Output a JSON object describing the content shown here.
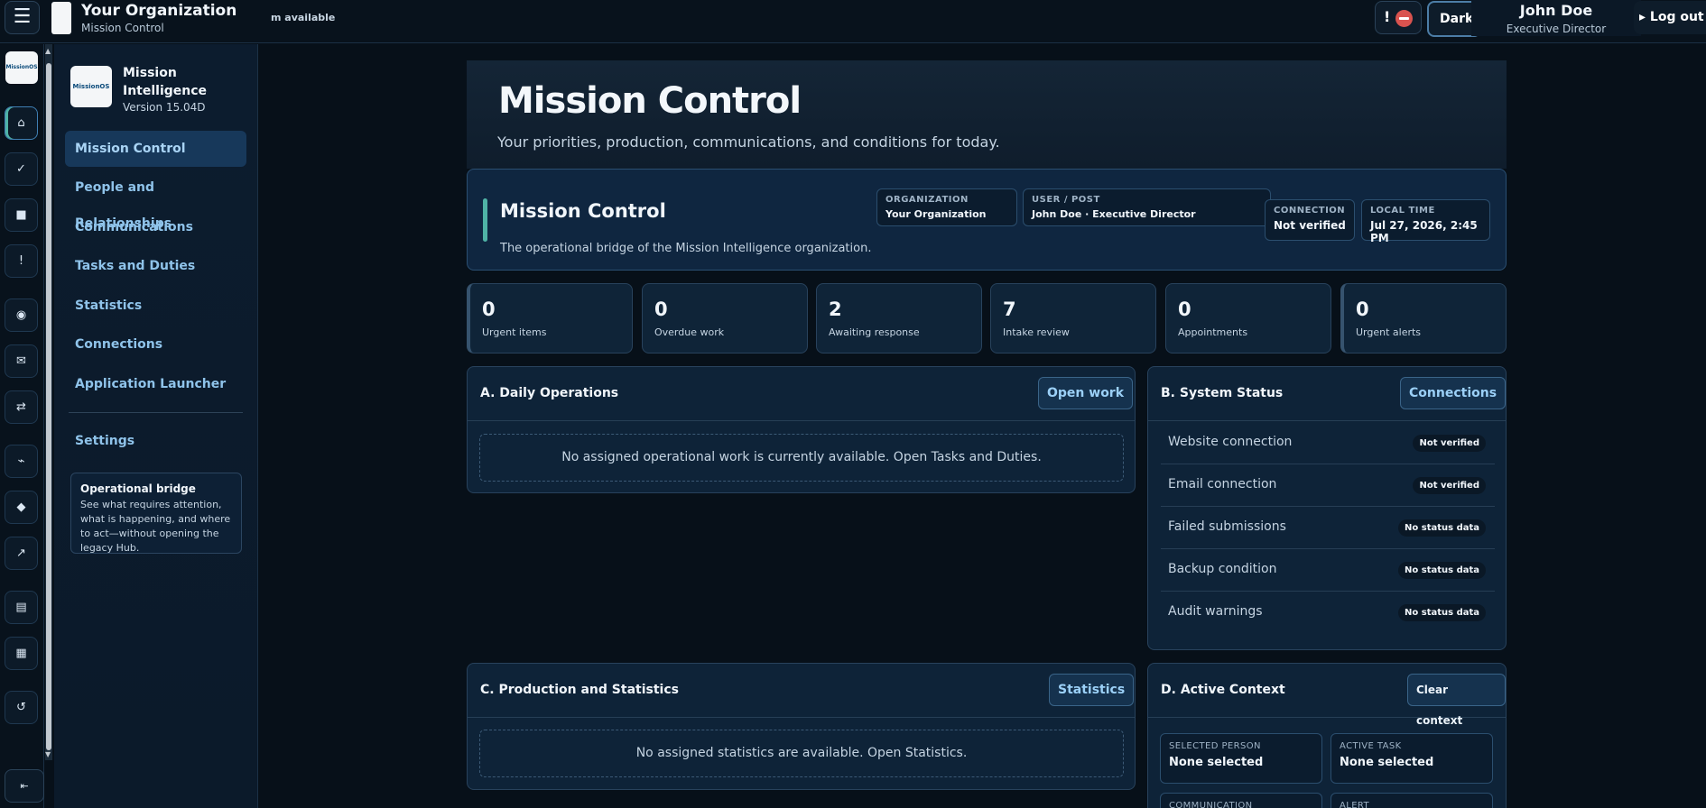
{
  "topbar": {
    "menu_glyph": "☰",
    "org_title": "Your Organization",
    "org_subtitle": "Mission Control",
    "availability_text": "m available",
    "alert_glyph": "!",
    "theme_label": "Dark",
    "user_name": "John Doe",
    "user_role": "Executive Director",
    "logout_label": "Log out",
    "logout_glyph": "▸"
  },
  "rail": {
    "logo_text": "MissionOS",
    "items": [
      {
        "glyph": "⌂",
        "icon": "home-icon"
      },
      {
        "glyph": "✓",
        "icon": "check-icon"
      },
      {
        "glyph": "■",
        "icon": "square-icon"
      },
      {
        "glyph": "!",
        "icon": "alert-icon"
      },
      {
        "glyph": "◉",
        "icon": "people-icon"
      },
      {
        "glyph": "✉",
        "icon": "mail-icon"
      },
      {
        "glyph": "⇄",
        "icon": "exchange-icon"
      },
      {
        "glyph": "⌁",
        "icon": "chart-icon"
      },
      {
        "glyph": "◆",
        "icon": "diamond-icon"
      },
      {
        "glyph": "↗",
        "icon": "launch-icon"
      },
      {
        "glyph": "▤",
        "icon": "list-icon"
      },
      {
        "glyph": "▦",
        "icon": "grid-icon"
      },
      {
        "glyph": "↺",
        "icon": "refresh-icon"
      }
    ],
    "collapse_glyph": "⇤"
  },
  "sidebar": {
    "brand_logo_text": "MissionOS",
    "brand_name": "Mission Intelligence",
    "version": "Version 15.04D",
    "items": [
      {
        "label": "Mission Control",
        "active": true
      },
      {
        "label": "People and Relationships"
      },
      {
        "label": "Communications"
      },
      {
        "label": "Tasks and Duties"
      },
      {
        "label": "Statistics"
      },
      {
        "label": "Connections"
      },
      {
        "label": "Application Launcher"
      }
    ],
    "settings_label": "Settings",
    "bridge": {
      "title": "Operational bridge",
      "text": "See what requires attention, what is happening, and where to act—without opening the legacy Hub."
    }
  },
  "hero": {
    "title": "Mission Control",
    "subtitle": "Your priorities, production, communications, and conditions for today."
  },
  "mc_panel": {
    "title": "Mission Control",
    "subtitle": "The operational bridge of the Mission Intelligence organization.",
    "org_label": "ORGANIZATION",
    "org_value": "Your Organization",
    "user_label": "USER / POST",
    "user_value": "John Doe · Executive Director",
    "conn_label": "CONNECTION",
    "conn_value": "Not verified",
    "time_label": "LOCAL TIME",
    "time_value": "Jul 27, 2026, 2:45 PM"
  },
  "kpis": [
    {
      "value": "0",
      "label": "Urgent items"
    },
    {
      "value": "0",
      "label": "Overdue work"
    },
    {
      "value": "2",
      "label": "Awaiting response"
    },
    {
      "value": "7",
      "label": "Intake review"
    },
    {
      "value": "0",
      "label": "Appointments"
    },
    {
      "value": "0",
      "label": "Urgent alerts"
    }
  ],
  "daily_ops": {
    "title": "A. Daily Operations",
    "button": "Open work",
    "empty": "No assigned operational work is currently available. Open Tasks and Duties."
  },
  "system_status": {
    "title": "B. System Status",
    "button": "Connections",
    "rows": [
      {
        "label": "Website connection",
        "status": "Not verified"
      },
      {
        "label": "Email connection",
        "status": "Not verified"
      },
      {
        "label": "Failed submissions",
        "status": "No status data"
      },
      {
        "label": "Backup condition",
        "status": "No status data"
      },
      {
        "label": "Audit warnings",
        "status": "No status data"
      }
    ]
  },
  "production": {
    "title": "C. Production and Statistics",
    "button": "Statistics",
    "empty": "No assigned statistics are available. Open Statistics."
  },
  "active_context": {
    "title": "D. Active Context",
    "button": "Clear context",
    "person_label": "SELECTED PERSON",
    "person_value": "None selected",
    "task_label": "ACTIVE TASK",
    "task_value": "None selected",
    "comm_label": "COMMUNICATION",
    "alert_label": "ALERT"
  },
  "colors": {
    "accent_teal": "#4fb3a6",
    "link_blue": "#8fc3ea",
    "alert_red": "#d9534f"
  }
}
